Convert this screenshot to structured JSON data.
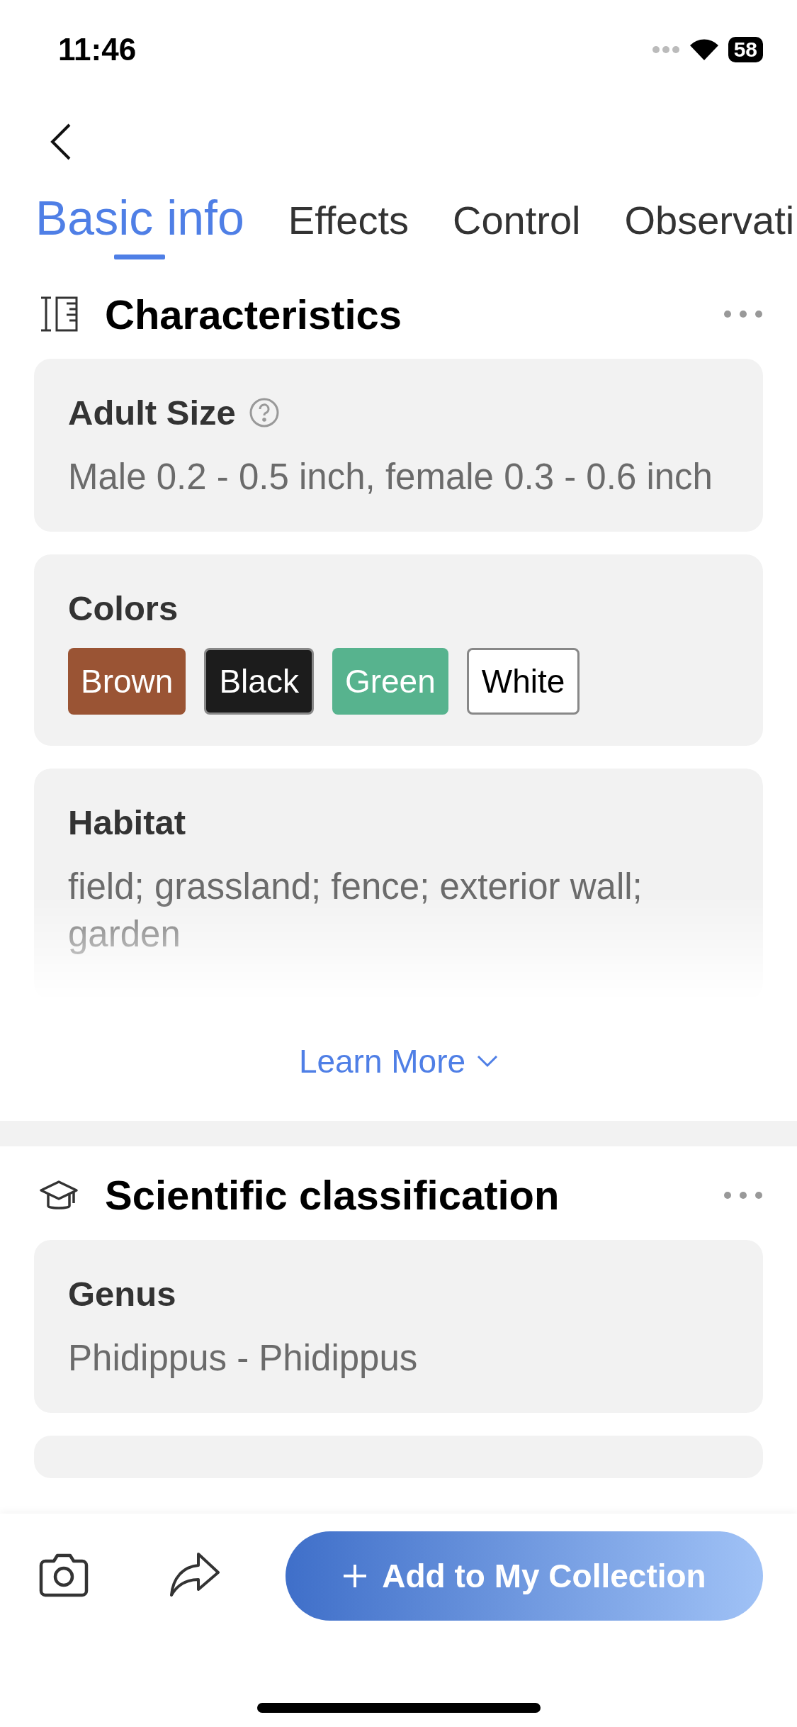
{
  "status_bar": {
    "time": "11:46",
    "battery": "58"
  },
  "tabs": [
    {
      "label": "Basic info",
      "selected": true
    },
    {
      "label": "Effects",
      "selected": false
    },
    {
      "label": "Control",
      "selected": false
    },
    {
      "label": "Observati",
      "selected": false
    }
  ],
  "sections": [
    {
      "kind": "characteristics",
      "title": "Characteristics",
      "cards": [
        {
          "kind": "text",
          "title": "Adult Size",
          "help": true,
          "value": "Male 0.2 - 0.5 inch, female 0.3 - 0.6 inch",
          "faded": false
        },
        {
          "kind": "chips",
          "title": "Colors",
          "chips": [
            {
              "label": "Brown",
              "color": "#9a5434"
            },
            {
              "label": "Black",
              "color": "#1c1c1c"
            },
            {
              "label": "Green",
              "color": "#57b38e"
            },
            {
              "label": "White",
              "color": "#ffffff"
            }
          ]
        },
        {
          "kind": "text",
          "title": "Habitat",
          "help": false,
          "value": "field; grassland; fence; exterior wall; garden",
          "faded": true
        }
      ],
      "learn_more": "Learn More"
    },
    {
      "kind": "classification",
      "title": "Scientific classification",
      "cards": [
        {
          "kind": "text",
          "title": "Genus",
          "help": false,
          "value": "Phidippus - Phidippus",
          "faded": false
        },
        {
          "kind": "empty"
        }
      ]
    }
  ],
  "bottom_bar": {
    "button": "Add to My Collection"
  }
}
